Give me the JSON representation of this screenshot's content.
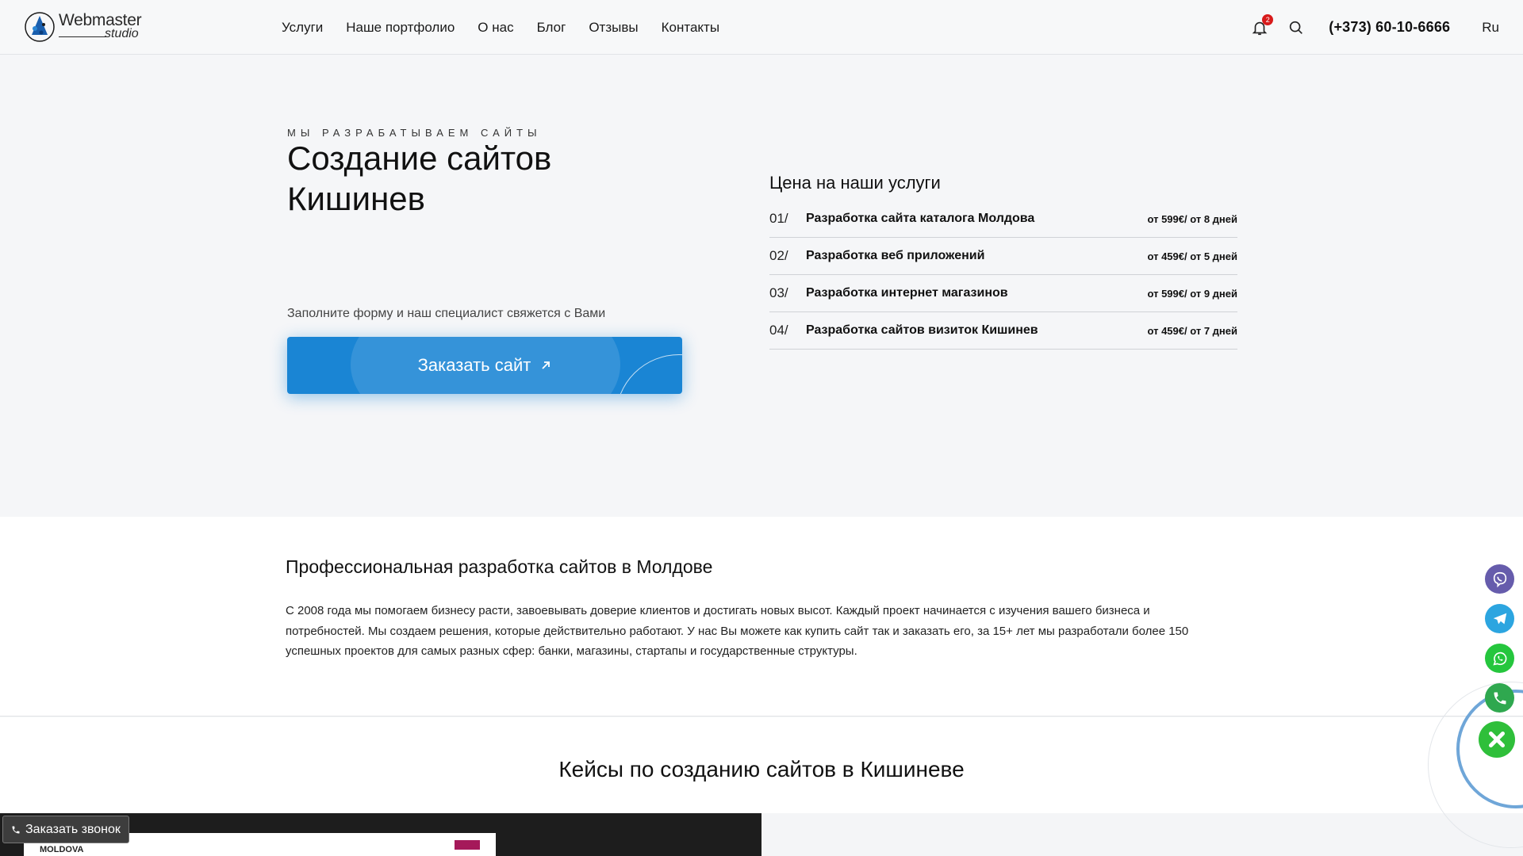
{
  "header": {
    "logo": {
      "text": "Webmaster",
      "sub": "studio"
    },
    "nav": [
      "Услуги",
      "Наше портфолио",
      "О нас",
      "Блог",
      "Отзывы",
      "Контакты"
    ],
    "notifications_count": "2",
    "phone": "(+373) 60-10-6666",
    "language": "Ru",
    "icons": [
      "bell-icon",
      "search-icon"
    ]
  },
  "hero": {
    "eyebrow": "МЫ РАЗРАБАТЫВАЕМ САЙТЫ",
    "title": "Создание сайтов Кишинев",
    "subtitle": "Заполните форму и наш специалист свяжется с Вами",
    "cta_label": "Заказать сайт",
    "cta_color": "#1a85d4"
  },
  "prices": {
    "title": "Цена на наши услуги",
    "items": [
      {
        "num": "01/",
        "name": "Разработка сайта каталога Молдова",
        "price": "от 599€/ от 8 дней"
      },
      {
        "num": "02/",
        "name": "Разработка веб приложений",
        "price": "от 459€/ от 5 дней"
      },
      {
        "num": "03/",
        "name": "Разработка интернет магазинов",
        "price": "от 599€/ от 9 дней"
      },
      {
        "num": "04/",
        "name": "Разработка сайтов визиток Кишинев",
        "price": "от 459€/ от 7 дней"
      }
    ]
  },
  "about": {
    "title": "Профессиональная разработка сайтов в Молдове",
    "text": "С 2008 года мы помогаем бизнесу расти, завоевывать доверие клиентов и достигать новых высот. Каждый проект начинается с изучения вашего бизнеса и потребностей. Мы создаем решения, которые действительно работают. У нас Вы можете как купить сайт так и заказать его, за 15+ лет мы разработали более 150 успешных проектов для самых разных сфер: банки, магазины, стартапы и государственные структуры."
  },
  "cases": {
    "title": "Кейсы по созданию сайтов в Кишиневе",
    "preview_logo": "MOLDOVA"
  },
  "callback_label": "Заказать звонок",
  "floating": {
    "buttons": [
      {
        "name": "viber",
        "color": "#665cac"
      },
      {
        "name": "telegram",
        "color": "#2ca5e0"
      },
      {
        "name": "whatsapp",
        "color": "#25c63d"
      },
      {
        "name": "phone",
        "color": "#2fa84f"
      }
    ],
    "close_color": "#2fbf3a"
  }
}
